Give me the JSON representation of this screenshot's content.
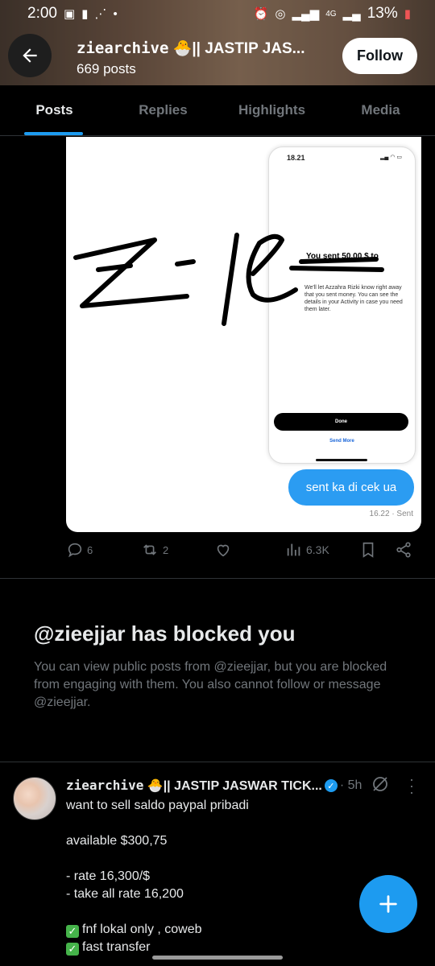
{
  "status_bar": {
    "time": "2:00",
    "battery": "13%",
    "network": "4G"
  },
  "profile_header": {
    "name_handle_part": "ziearchive",
    "name_rest": "🐣|| JASTIP JAS...",
    "posts_count": "669 posts",
    "follow_label": "Follow"
  },
  "tabs": [
    {
      "label": "Posts",
      "active": true
    },
    {
      "label": "Replies",
      "active": false
    },
    {
      "label": "Highlights",
      "active": false
    },
    {
      "label": "Media",
      "active": false
    }
  ],
  "media_post": {
    "phone_time": "18.21",
    "sent_text": "You sent 50.00 $ to",
    "sent_subtext": "We'll let Azzahra Rizki know right away that you sent money. You can see the details in your Activity in case you need them later.",
    "done_label": "Done",
    "send_more_label": "Send More",
    "bubble_text": "sent ka di cek ua",
    "bubble_time": "16.22 · Sent"
  },
  "media_actions": {
    "replies": "6",
    "reposts": "2",
    "views": "6.3K"
  },
  "blocked_notice": {
    "title": "@zieejjar has blocked you",
    "description": "You can view public posts from @zieejjar, but you are blocked from engaging with them. You also cannot follow or message @zieejjar."
  },
  "post": {
    "author_handle_part": "ziearchive",
    "author_rest": "🐣|| JASTIP JASWAR TICK...",
    "time": "· 5h",
    "lines": [
      "want to sell saldo paypal pribadi",
      "",
      "available $300,75",
      "",
      "- rate 16,300/$",
      "- take all rate 16,200",
      "",
      "fnf lokal only , coweb",
      "fast transfer"
    ]
  },
  "colors": {
    "accent": "#1d9bf0",
    "background": "#000000",
    "muted": "#71767b",
    "text": "#e7e9ea"
  }
}
